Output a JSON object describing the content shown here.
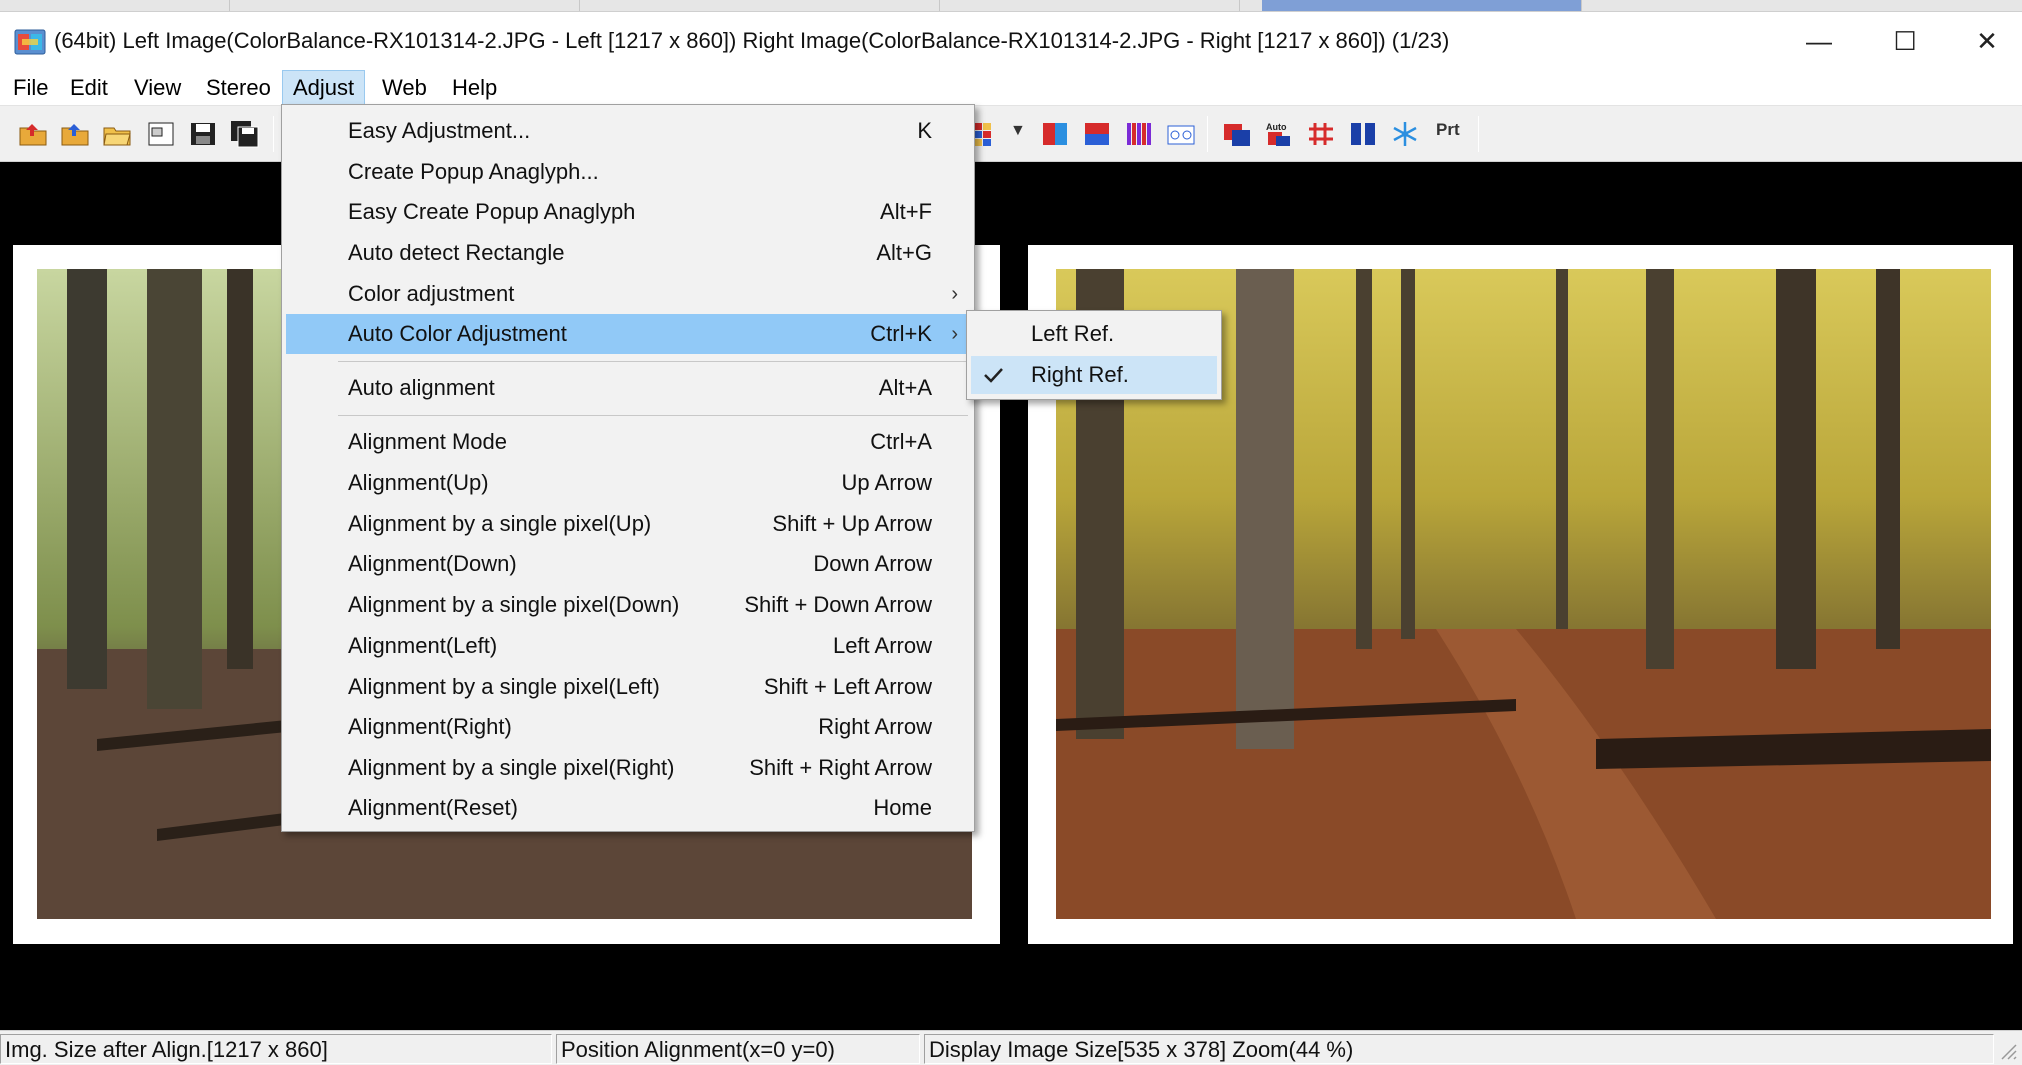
{
  "window": {
    "title": "(64bit) Left Image(ColorBalance-RX101314-2.JPG - Left [1217 x 860]) Right Image(ColorBalance-RX101314-2.JPG - Right [1217 x 860])  (1/23)",
    "minimize": "—",
    "maximize": "☐",
    "close": "✕"
  },
  "menubar": {
    "file": "File",
    "edit": "Edit",
    "view": "View",
    "stereo": "Stereo",
    "adjust": "Adjust",
    "web": "Web",
    "help": "Help"
  },
  "toolbar": {
    "auto_label": "Auto",
    "print_label": "Prt"
  },
  "adjust_menu": {
    "items": [
      {
        "label": "Easy Adjustment...",
        "shortcut": "K"
      },
      {
        "label": "Create Popup Anaglyph...",
        "shortcut": ""
      },
      {
        "label": "Easy Create Popup Anaglyph",
        "shortcut": "Alt+F"
      },
      {
        "label": "Auto detect Rectangle",
        "shortcut": "Alt+G"
      },
      {
        "label": "Color adjustment",
        "shortcut": ""
      },
      {
        "label": "Auto Color Adjustment",
        "shortcut": "Ctrl+K"
      },
      {
        "label": "Auto alignment",
        "shortcut": "Alt+A"
      },
      {
        "label": "Alignment Mode",
        "shortcut": "Ctrl+A"
      },
      {
        "label": "Alignment(Up)",
        "shortcut": "Up Arrow"
      },
      {
        "label": "Alignment by a single pixel(Up)",
        "shortcut": "Shift + Up Arrow"
      },
      {
        "label": "Alignment(Down)",
        "shortcut": "Down Arrow"
      },
      {
        "label": "Alignment by a single pixel(Down)",
        "shortcut": "Shift + Down Arrow"
      },
      {
        "label": "Alignment(Left)",
        "shortcut": "Left Arrow"
      },
      {
        "label": "Alignment by a single pixel(Left)",
        "shortcut": "Shift + Left Arrow"
      },
      {
        "label": "Alignment(Right)",
        "shortcut": "Right Arrow"
      },
      {
        "label": "Alignment by a single pixel(Right)",
        "shortcut": "Shift + Right Arrow"
      },
      {
        "label": "Alignment(Reset)",
        "shortcut": "Home"
      }
    ],
    "submenu_arrow": "›"
  },
  "auto_color_submenu": {
    "items": [
      {
        "label": "Left Ref.",
        "checked": false
      },
      {
        "label": "Right Ref.",
        "checked": true
      }
    ]
  },
  "statusbar": {
    "img_size": "Img. Size after Align.[1217 x 860]",
    "position": "Position Alignment(x=0 y=0)",
    "display": "Display Image Size[535 x 378]  Zoom(44 %)"
  },
  "colors": {
    "menu_highlight": "#91c9f7",
    "menu_open": "#cce4f7",
    "background": "#000000"
  }
}
